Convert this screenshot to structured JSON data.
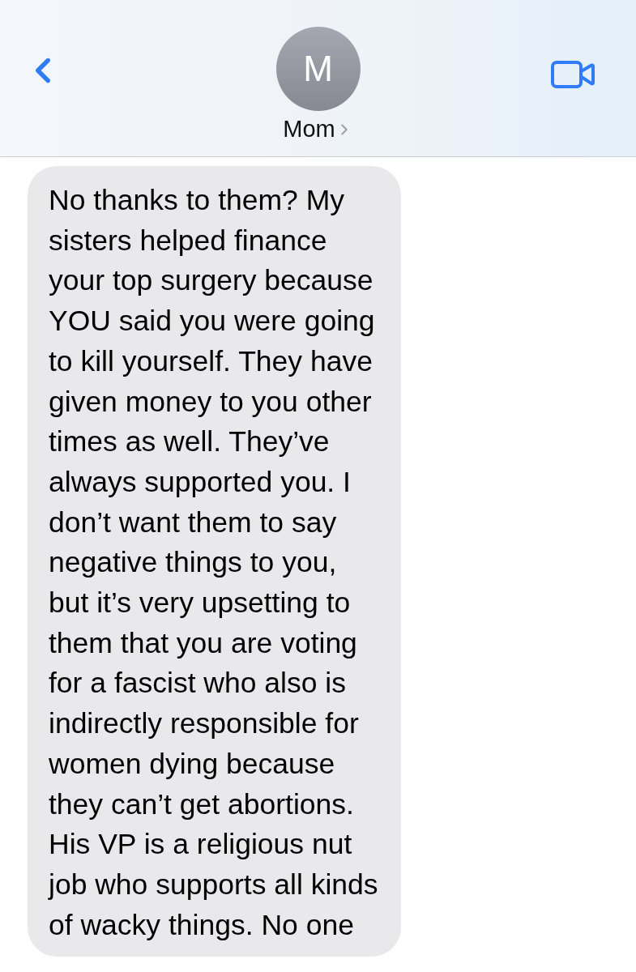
{
  "contact": {
    "initial": "M",
    "name": "Mom"
  },
  "messages": [
    {
      "kind": "incoming",
      "text": "No thanks to them? My\nsisters helped finance\nyour top surgery because\nYOU said you were going\nto kill yourself. They have\ngiven money to you other\ntimes as well. They’ve\nalways supported you. I\ndon’t want them to say\nnegative things to you,\nbut it’s very upsetting to\nthem that you are voting\nfor a fascist who also is\nindirectly responsible for\nwomen dying because\nthey can’t get abortions.\nHis VP is a religious nut\njob who supports all kinds\nof wacky things. No one"
    }
  ]
}
